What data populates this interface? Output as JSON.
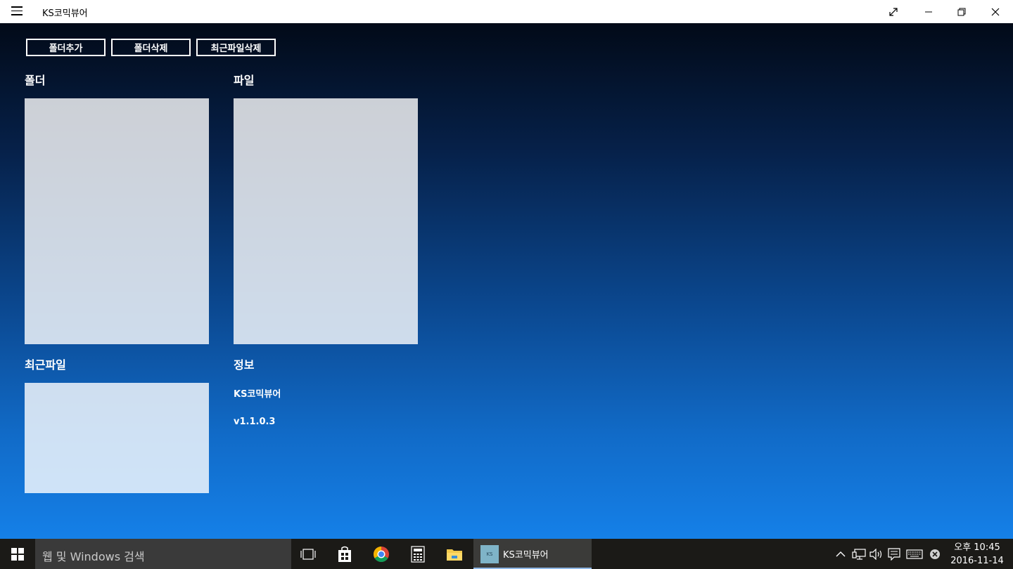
{
  "window": {
    "title": "KS코믹뷰어",
    "titlebar_bg": "#ffffff",
    "controls": [
      "fullscreen-icon",
      "minimize-icon",
      "restore-icon",
      "close-icon"
    ]
  },
  "toolbar": {
    "add_folder_label": "폴더추가",
    "delete_folder_label": "폴더삭제",
    "delete_recent_label": "최근파일삭제"
  },
  "sections": {
    "folder_title": "폴더",
    "file_title": "파일",
    "recent_title": "최근파일",
    "info_title": "정보"
  },
  "info": {
    "app_name": "KS코믹뷰어",
    "version": "v1.1.0.3"
  },
  "taskbar": {
    "search_placeholder": "웹 및 Windows 검색",
    "pinned": [
      "task-view-icon",
      "store-icon",
      "chrome-icon",
      "calculator-icon",
      "file-explorer-icon"
    ],
    "active_app_label": "KS코믹뷰어",
    "active_app_icon_text": "KS",
    "tray_icons": [
      "chevron-up-icon",
      "network-icon",
      "volume-icon",
      "action-center-icon",
      "keyboard-icon",
      "close-circle-icon"
    ],
    "clock_time": "오후 10:45",
    "clock_date": "2016-11-14"
  },
  "colors": {
    "gradient_top": "#020a18",
    "gradient_bottom": "#1580e8",
    "taskbar_bg": "#1b1a17",
    "panel_fill": "#ffffff"
  }
}
